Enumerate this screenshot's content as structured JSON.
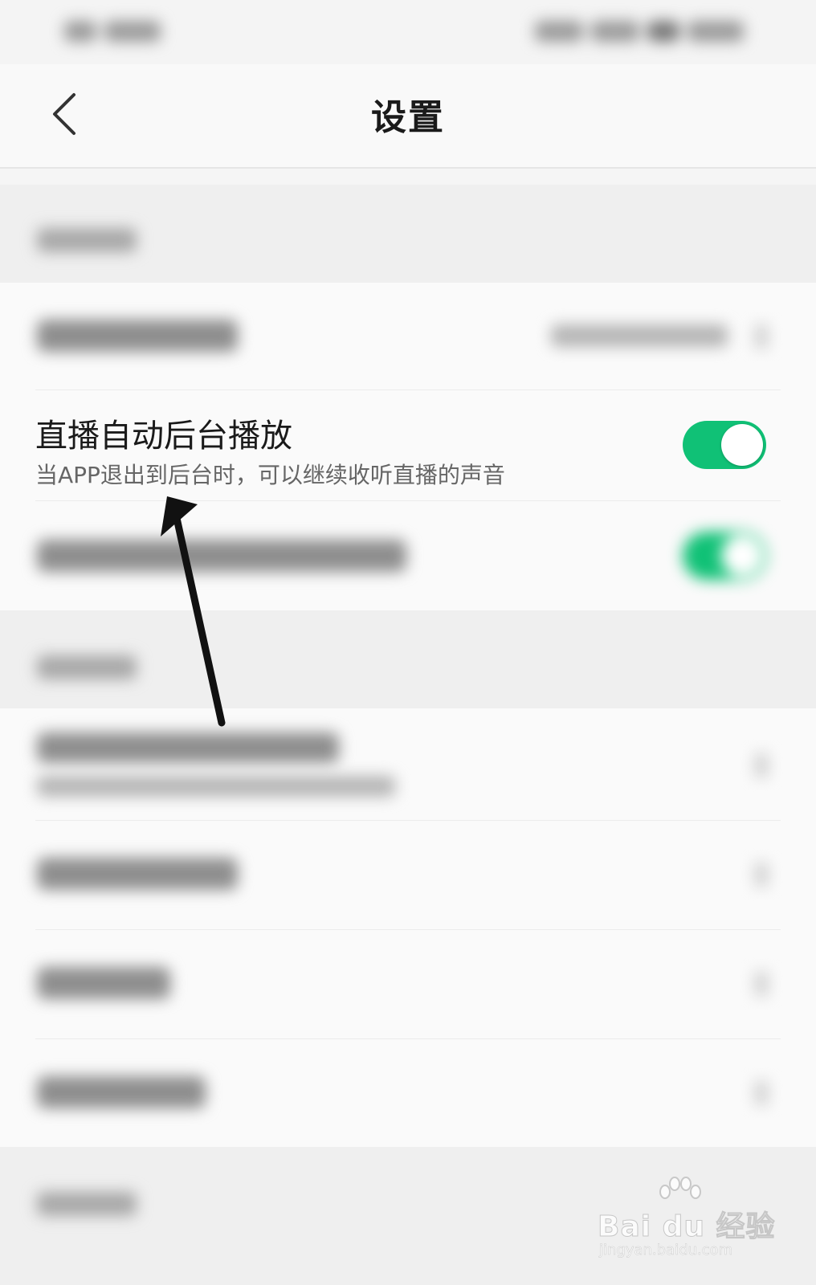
{
  "header": {
    "title": "设置",
    "back_icon": "chevron-left-icon"
  },
  "live_background_setting": {
    "title": "直播自动后台播放",
    "subtitle": "当APP退出到后台时，可以继续收听直播的声音",
    "toggle_on": true,
    "toggle_color": "#10c176"
  },
  "watermark": {
    "main": "Bai du 经验",
    "sub": "jingyan.baidu.com"
  },
  "annotation": {
    "arrow_color": "#111111",
    "icon": "arrow-up-icon"
  }
}
